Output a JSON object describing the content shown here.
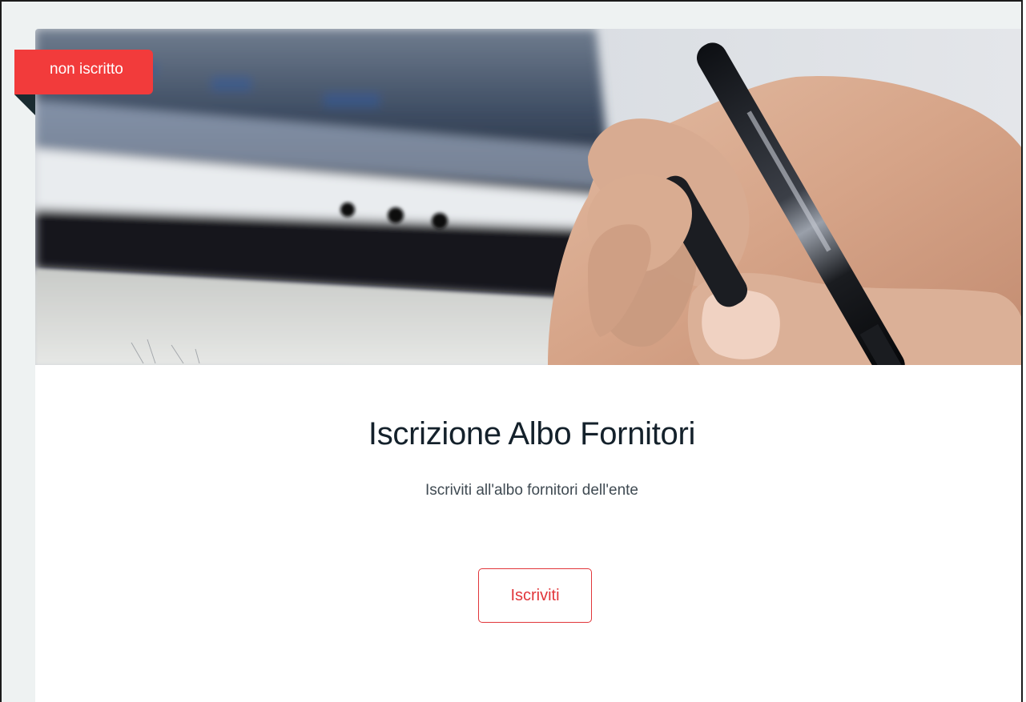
{
  "card": {
    "status_badge": "non iscritto",
    "title": "Iscrizione Albo Fornitori",
    "subtitle": "Iscriviti all'albo fornitori dell'ente",
    "cta_label": "Iscriviti",
    "hero_image": "hand-writing-with-pen-icon"
  },
  "colors": {
    "accent": "#f23b3b",
    "cta_text": "#e1363a",
    "title": "#14212b",
    "background": "#eef2f2"
  }
}
